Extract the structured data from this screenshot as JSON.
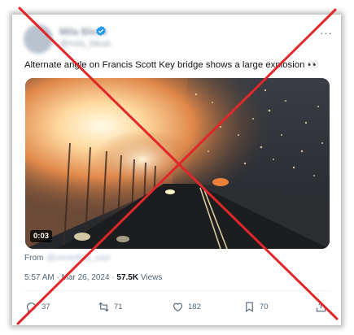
{
  "post": {
    "author_name": "Mila Blesk",
    "author_handle": "@mila_blesk",
    "text": "Alternate angle on Francis Scott Key bridge shows a large explosion 👀",
    "video_duration": "0:03",
    "from_label": "From",
    "from_source": "@unverified_user",
    "timestamp": "5:57 AM · Mar 26, 2024 · ",
    "views_count": "57.5K",
    "views_label": " Views",
    "more_glyph": "···"
  },
  "actions": {
    "replies": "37",
    "reposts": "71",
    "likes": "182",
    "bookmarks": "70"
  },
  "icons": [
    "verified-badge-icon",
    "reply-icon",
    "repost-icon",
    "like-icon",
    "bookmark-icon",
    "share-icon"
  ],
  "colors": {
    "accent": "#1d9bf0",
    "cross": "#e0282a",
    "muted": "#536471"
  }
}
